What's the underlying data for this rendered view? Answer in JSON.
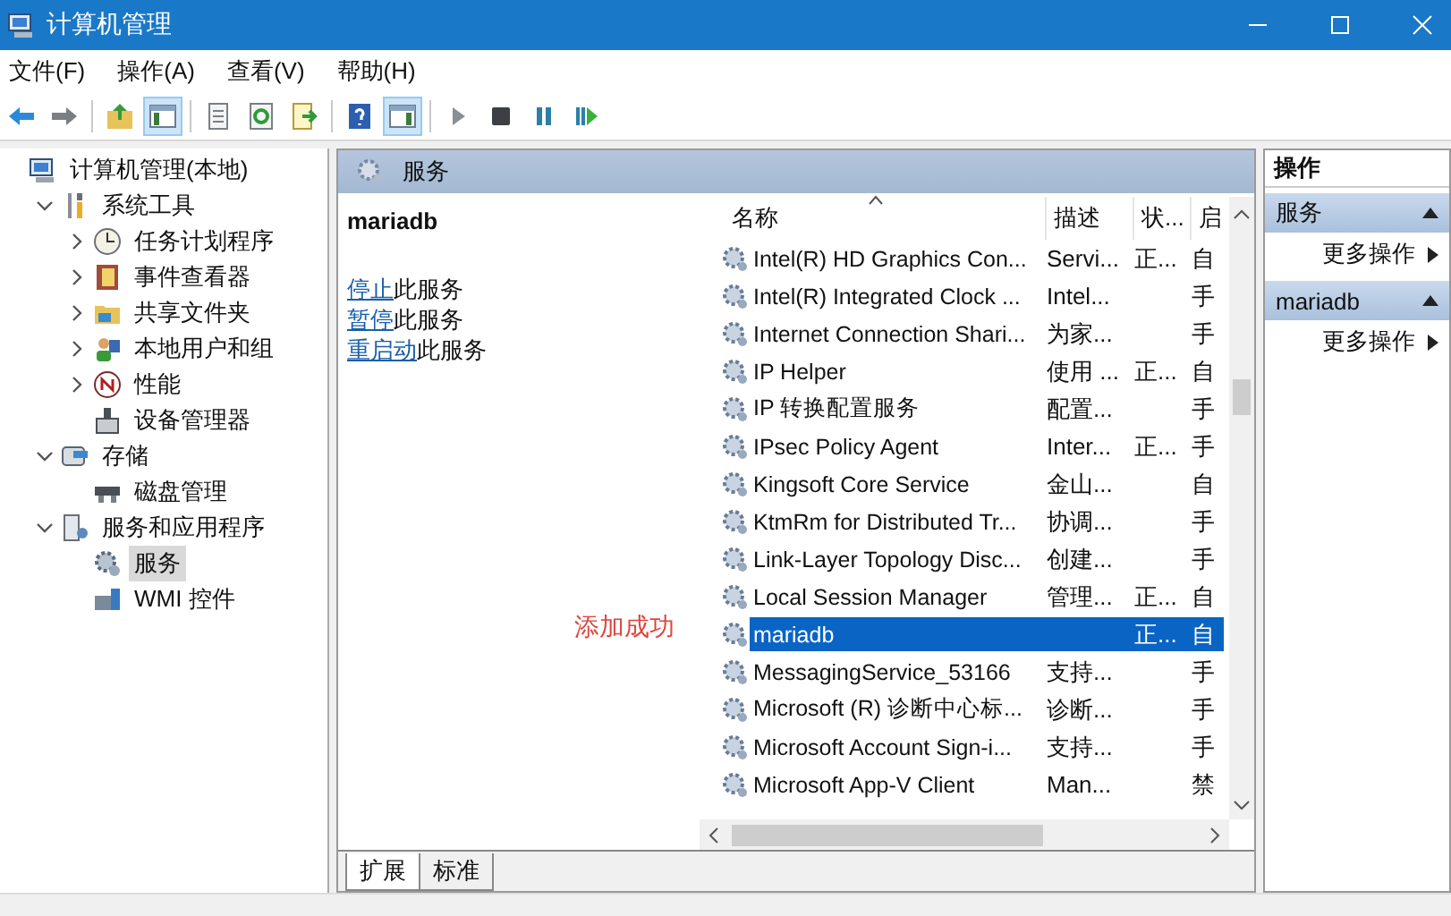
{
  "window": {
    "title": "计算机管理"
  },
  "menu": [
    "文件(F)",
    "操作(A)",
    "查看(V)",
    "帮助(H)"
  ],
  "toolbar": [
    {
      "kind": "back",
      "pressed": false
    },
    {
      "kind": "forward",
      "pressed": false
    },
    {
      "kind": "separator"
    },
    {
      "kind": "up",
      "pressed": false
    },
    {
      "kind": "tree",
      "pressed": true
    },
    {
      "kind": "separator"
    },
    {
      "kind": "properties",
      "pressed": false
    },
    {
      "kind": "refresh",
      "pressed": false
    },
    {
      "kind": "export",
      "pressed": false
    },
    {
      "kind": "separator"
    },
    {
      "kind": "help",
      "pressed": false
    },
    {
      "kind": "actionpane",
      "pressed": true
    },
    {
      "kind": "separator"
    },
    {
      "kind": "start",
      "pressed": false
    },
    {
      "kind": "stop",
      "pressed": false
    },
    {
      "kind": "pause",
      "pressed": false
    },
    {
      "kind": "resume",
      "pressed": false
    }
  ],
  "tree": [
    {
      "label": "计算机管理(本地)",
      "selected": false,
      "children": [
        {
          "label": "系统工具",
          "expanded": true,
          "selected": false,
          "children": [
            {
              "label": "任务计划程序",
              "expanded": false,
              "selected": false
            },
            {
              "label": "事件查看器",
              "expanded": false,
              "selected": false
            },
            {
              "label": "共享文件夹",
              "expanded": false,
              "selected": false
            },
            {
              "label": "本地用户和组",
              "expanded": false,
              "selected": false
            },
            {
              "label": "性能",
              "expanded": false,
              "selected": false
            },
            {
              "label": "设备管理器",
              "selected": false
            }
          ]
        },
        {
          "label": "存储",
          "expanded": true,
          "selected": false,
          "children": [
            {
              "label": "磁盘管理",
              "selected": false
            }
          ]
        },
        {
          "label": "服务和应用程序",
          "expanded": true,
          "selected": false,
          "children": [
            {
              "label": "服务",
              "selected": true
            },
            {
              "label": "WMI 控件",
              "selected": false
            }
          ]
        }
      ]
    }
  ],
  "services_panel": {
    "title": "服务",
    "service_name": "mariadb",
    "actions": [
      {
        "link": "停止",
        "text": "此服务"
      },
      {
        "link": "暂停",
        "text": "此服务"
      },
      {
        "link": "重启动",
        "text": "此服务"
      }
    ],
    "annotation": "添加成功",
    "columns": [
      {
        "label": "名称",
        "sorted": true
      },
      {
        "label": "描述",
        "sorted": false
      },
      {
        "label": "状...",
        "sorted": false
      },
      {
        "label": "启",
        "sorted": false
      }
    ],
    "rows": [
      {
        "name": "Intel(R) HD Graphics Con...",
        "description": "Servi...",
        "status": "正...",
        "startup": "自",
        "selected": false
      },
      {
        "name": "Intel(R) Integrated Clock ...",
        "description": "Intel...",
        "status": "",
        "startup": "手",
        "selected": false
      },
      {
        "name": "Internet Connection Shari...",
        "description": "为家...",
        "status": "",
        "startup": "手",
        "selected": false
      },
      {
        "name": "IP Helper",
        "description": "使用 ...",
        "status": "正...",
        "startup": "自",
        "selected": false
      },
      {
        "name": "IP 转换配置服务",
        "description": "配置...",
        "status": "",
        "startup": "手",
        "selected": false
      },
      {
        "name": "IPsec Policy Agent",
        "description": "Inter...",
        "status": "正...",
        "startup": "手",
        "selected": false
      },
      {
        "name": "Kingsoft Core Service",
        "description": "金山...",
        "status": "",
        "startup": "自",
        "selected": false
      },
      {
        "name": "KtmRm for Distributed Tr...",
        "description": "协调...",
        "status": "",
        "startup": "手",
        "selected": false
      },
      {
        "name": "Link-Layer Topology Disc...",
        "description": "创建...",
        "status": "",
        "startup": "手",
        "selected": false
      },
      {
        "name": "Local Session Manager",
        "description": "管理...",
        "status": "正...",
        "startup": "自",
        "selected": false
      },
      {
        "name": "mariadb",
        "description": "",
        "status": "正...",
        "startup": "自",
        "selected": true
      },
      {
        "name": "MessagingService_53166",
        "description": "支持...",
        "status": "",
        "startup": "手",
        "selected": false
      },
      {
        "name": "Microsoft (R) 诊断中心标...",
        "description": "诊断...",
        "status": "",
        "startup": "手",
        "selected": false
      },
      {
        "name": "Microsoft Account Sign-i...",
        "description": "支持...",
        "status": "",
        "startup": "手",
        "selected": false
      },
      {
        "name": "Microsoft App-V Client",
        "description": "Man...",
        "status": "",
        "startup": "禁",
        "selected": false
      }
    ],
    "tabs": [
      {
        "label": "扩展",
        "selected": true
      },
      {
        "label": "标准",
        "selected": false
      }
    ]
  },
  "actions_pane": {
    "title": "操作",
    "sections": [
      {
        "title": "服务",
        "items": [
          "更多操作"
        ]
      },
      {
        "title": "mariadb",
        "items": [
          "更多操作"
        ]
      }
    ]
  }
}
